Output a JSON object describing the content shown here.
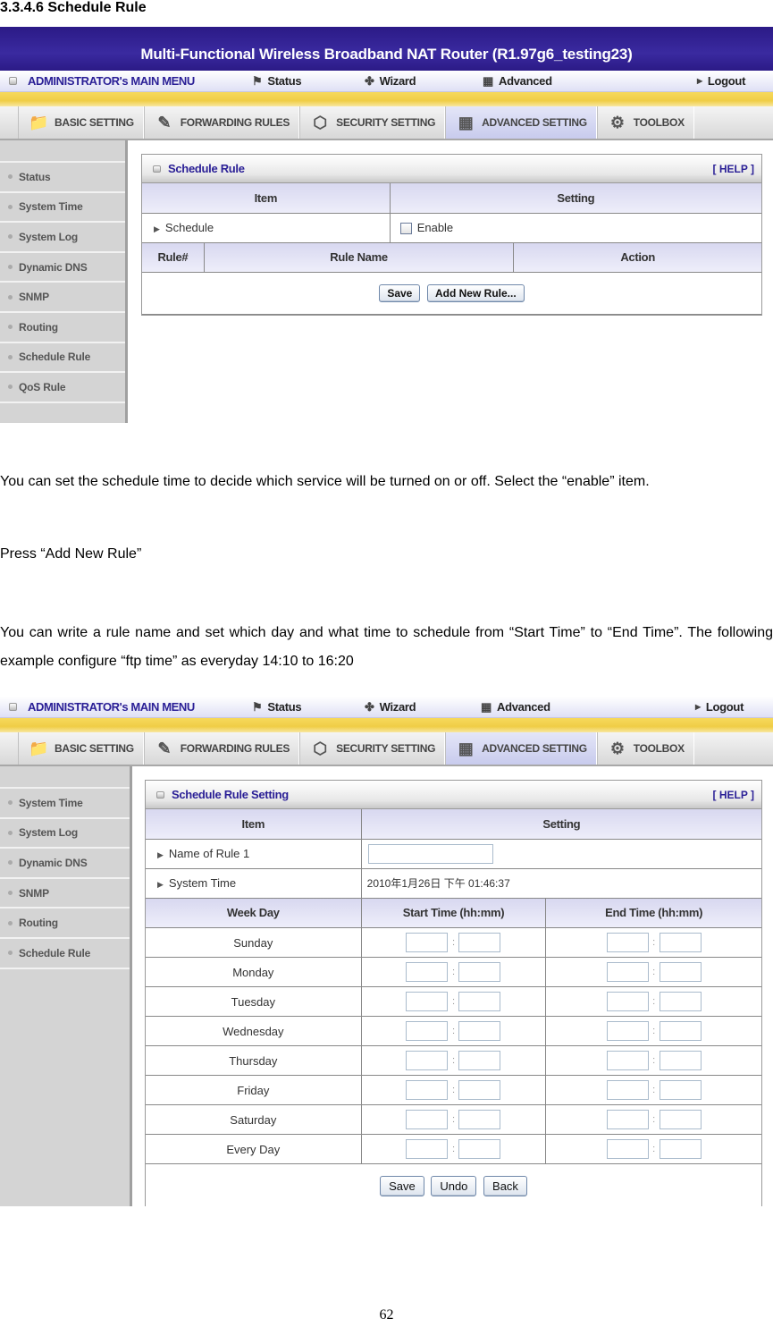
{
  "doc": {
    "heading": "3.3.4.6 Schedule Rule",
    "para1": "You can set the schedule time to decide which service will be turned on or off. Select the “enable” item.",
    "para2": "Press “Add New Rule”",
    "para3": "You can write a rule name and set which day and what time to schedule from “Start Time” to “End Time”. The following example configure “ftp time” as everyday 14:10 to 16:20",
    "page_number": "62"
  },
  "router": {
    "banner_title": "Multi-Functional Wireless Broadband NAT Router (R1.97g6_testing23)",
    "main_menu_label": "ADMINISTRATOR's MAIN MENU",
    "top_menu": [
      {
        "label": "Status",
        "icon": "status-person-icon"
      },
      {
        "label": "Wizard",
        "icon": "wizard-icon"
      },
      {
        "label": "Advanced",
        "icon": "advanced-icon"
      },
      {
        "label": "Logout",
        "icon": "arrow-right-icon"
      }
    ],
    "tabs": [
      {
        "label": "BASIC SETTING",
        "icon": "folder-icon"
      },
      {
        "label": "FORWARDING RULES",
        "icon": "forwarding-icon"
      },
      {
        "label": "SECURITY SETTING",
        "icon": "security-icon"
      },
      {
        "label": "ADVANCED SETTING",
        "icon": "advanced-setting-icon",
        "active": true
      },
      {
        "label": "TOOLBOX",
        "icon": "toolbox-icon"
      }
    ],
    "colors": {
      "banner": "#2b1a86",
      "accent_text": "#2a1f96",
      "yellow_bar": "#f0cd46",
      "table_header": "#d8d8f0",
      "sidebar": "#d4d4d4"
    }
  },
  "screen1": {
    "sidebar": [
      "Status",
      "System Time",
      "System Log",
      "Dynamic DNS",
      "SNMP",
      "Routing",
      "Schedule Rule",
      "QoS Rule"
    ],
    "panel_title": "Schedule Rule",
    "help_label": "[ HELP ]",
    "col_item": "Item",
    "col_setting": "Setting",
    "schedule_label": "Schedule",
    "enable_label": "Enable",
    "enable_checked": false,
    "rule_cols": [
      "Rule#",
      "Rule Name",
      "Action"
    ],
    "save_label": "Save",
    "add_rule_label": "Add New Rule..."
  },
  "screen2": {
    "sidebar": [
      "System Time",
      "System Log",
      "Dynamic DNS",
      "SNMP",
      "Routing",
      "Schedule Rule"
    ],
    "panel_title": "Schedule Rule Setting",
    "help_label": "[ HELP ]",
    "col_item": "Item",
    "col_setting": "Setting",
    "name_label": "Name of Rule 1",
    "name_value": "",
    "system_time_label": "System Time",
    "system_time_value": "2010年1月26日 下午 01:46:37",
    "col_weekday": "Week Day",
    "col_start": "Start Time (hh:mm)",
    "col_end": "End Time (hh:mm)",
    "days": [
      "Sunday",
      "Monday",
      "Tuesday",
      "Wednesday",
      "Thursday",
      "Friday",
      "Saturday",
      "Every Day"
    ],
    "time_separator": ":",
    "save_label": "Save",
    "undo_label": "Undo",
    "back_label": "Back"
  }
}
